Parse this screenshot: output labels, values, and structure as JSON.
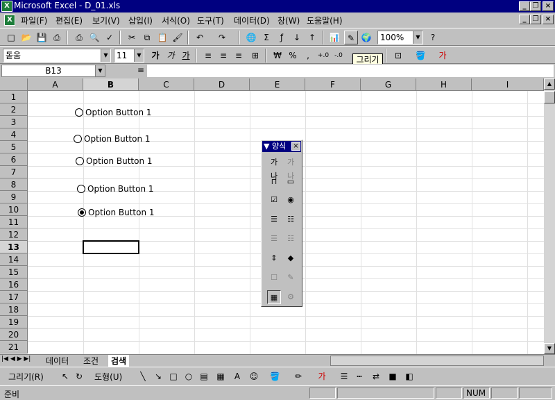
{
  "window": {
    "title": "Microsoft Excel - D_01.xls"
  },
  "menu": [
    "파일(F)",
    "편집(E)",
    "보기(V)",
    "삽입(I)",
    "서식(O)",
    "도구(T)",
    "데이터(D)",
    "창(W)",
    "도움말(H)"
  ],
  "toolbar": {
    "zoom": "100%"
  },
  "format": {
    "font": "돋움",
    "size": "11",
    "bold": "가",
    "italic": "가",
    "underline": "가"
  },
  "tooltip": "그리기",
  "formula_bar": {
    "name_box": "B13",
    "equals": "="
  },
  "columns": [
    "A",
    "B",
    "C",
    "D",
    "E",
    "F",
    "G",
    "H",
    "I"
  ],
  "rows": [
    "1",
    "2",
    "3",
    "4",
    "5",
    "6",
    "7",
    "8",
    "9",
    "10",
    "11",
    "12",
    "13",
    "14",
    "15",
    "16",
    "17",
    "18",
    "19",
    "20",
    "21"
  ],
  "option_buttons": [
    {
      "label": "Option Button 1"
    },
    {
      "label": "Option Button 1"
    },
    {
      "label": "Option Button 1"
    },
    {
      "label": "Option Button 1"
    },
    {
      "label": "Option Button 1"
    }
  ],
  "forms_toolbar": {
    "title": "양식",
    "label_btn": "가나",
    "edit_btn": "가나"
  },
  "sheet_tabs": [
    "데이터",
    "조건",
    "검색"
  ],
  "drawing": {
    "draw_label": "그리기(R)",
    "shapes_label": "도형(U)"
  },
  "status": {
    "ready": "준비",
    "num": "NUM"
  }
}
